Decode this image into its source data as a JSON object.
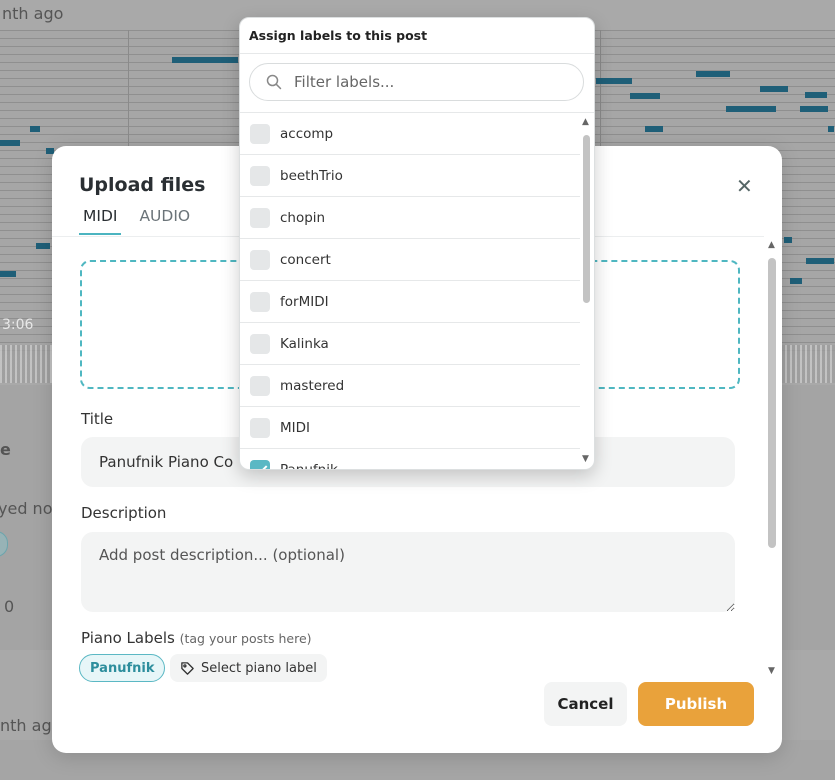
{
  "background": {
    "top_text": "nth ago",
    "time": "3:06",
    "left_frag_1": "e",
    "left_frag_2": "yed no",
    "left_frag_3": "0",
    "bottom_text": "nth ago"
  },
  "modal": {
    "title": "Upload files",
    "close_glyph": "✕",
    "tabs": [
      {
        "label": "MIDI",
        "active": true
      },
      {
        "label": "AUDIO",
        "active": false
      }
    ],
    "title_label": "Title",
    "title_value": "Panufnik Piano Co",
    "description_label": "Description",
    "description_placeholder": "Add post description... (optional)",
    "piano_labels_label": "Piano Labels",
    "piano_labels_hint": "(tag your posts here)",
    "selected_label": "Panufnik",
    "select_label_button": "Select piano label",
    "cancel_label": "Cancel",
    "publish_label": "Publish"
  },
  "label_picker": {
    "heading": "Assign labels to this post",
    "search_placeholder": "Filter labels...",
    "items": [
      {
        "label": "accomp",
        "checked": false
      },
      {
        "label": "beethTrio",
        "checked": false
      },
      {
        "label": "chopin",
        "checked": false
      },
      {
        "label": "concert",
        "checked": false
      },
      {
        "label": "forMIDI",
        "checked": false
      },
      {
        "label": "Kalinka",
        "checked": false
      },
      {
        "label": "mastered",
        "checked": false
      },
      {
        "label": "MIDI",
        "checked": false
      },
      {
        "label": "Panufnik",
        "checked": true
      }
    ]
  },
  "colors": {
    "accent": "#4fb7c1",
    "publish": "#e9a23b"
  }
}
